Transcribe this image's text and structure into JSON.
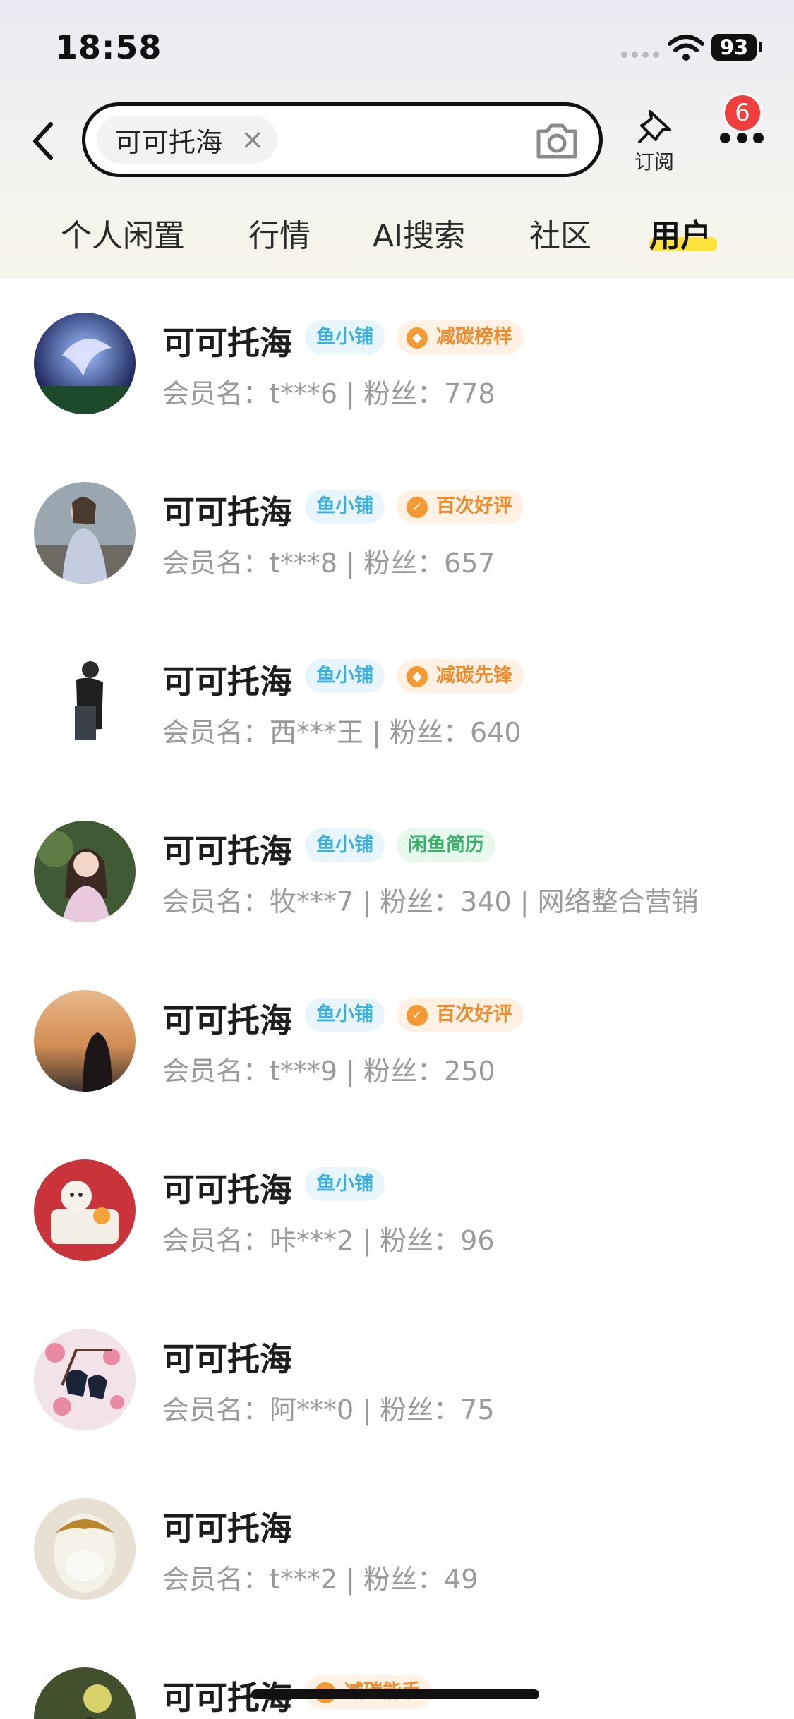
{
  "status_bar": {
    "time": "18:58",
    "battery": "93"
  },
  "search": {
    "query": "可可托海",
    "clear_symbol": "×"
  },
  "header": {
    "subscribe_label": "订阅",
    "notification_count": "6"
  },
  "tabs": [
    {
      "label": "个人闲置",
      "active": false
    },
    {
      "label": "行情",
      "active": false
    },
    {
      "label": "AI搜索",
      "active": false
    },
    {
      "label": "社区",
      "active": false
    },
    {
      "label": "用户",
      "active": true
    }
  ],
  "users": [
    {
      "name": "可可托海",
      "shop_tag": "鱼小铺",
      "honor_tag": "减碳榜样",
      "member": "会员名：t***6 | 粉丝：778",
      "avatar": "phoenix"
    },
    {
      "name": "可可托海",
      "shop_tag": "鱼小铺",
      "honor_tag": "百次好评",
      "member": "会员名：t***8 | 粉丝：657",
      "avatar": "woman-street"
    },
    {
      "name": "可可托海",
      "shop_tag": "鱼小铺",
      "honor_tag": "减碳先锋",
      "member": "会员名：西***王 | 粉丝：640",
      "avatar": "man-bag"
    },
    {
      "name": "可可托海",
      "shop_tag": "鱼小铺",
      "honor_tag": "闲鱼简历",
      "member": "会员名：牧***7 | 粉丝：340 | 网络整合营销",
      "avatar": "girl-garden"
    },
    {
      "name": "可可托海",
      "shop_tag": "鱼小铺",
      "honor_tag": "百次好评",
      "member": "会员名：t***9 | 粉丝：250",
      "avatar": "sunset"
    },
    {
      "name": "可可托海",
      "shop_tag": "鱼小铺",
      "honor_tag": "",
      "member": "会员名：咔***2 | 粉丝：96",
      "avatar": "lucky-cat"
    },
    {
      "name": "可可托海",
      "shop_tag": "",
      "honor_tag": "",
      "member": "会员名：阿***0 | 粉丝：75",
      "avatar": "magpies"
    },
    {
      "name": "可可托海",
      "shop_tag": "",
      "honor_tag": "",
      "member": "会员名：t***2 | 粉丝：49",
      "avatar": "jade"
    },
    {
      "name": "可可托海",
      "shop_tag": "",
      "honor_tag": "减碳能手",
      "member": "",
      "avatar": "bike"
    }
  ],
  "colors": {
    "accent_yellow": "#ffe33a",
    "badge_red": "#ef3e3b",
    "shop_blue": "#3bb0de",
    "honor_orange": "#f08b2c",
    "resume_green": "#36b36a"
  }
}
